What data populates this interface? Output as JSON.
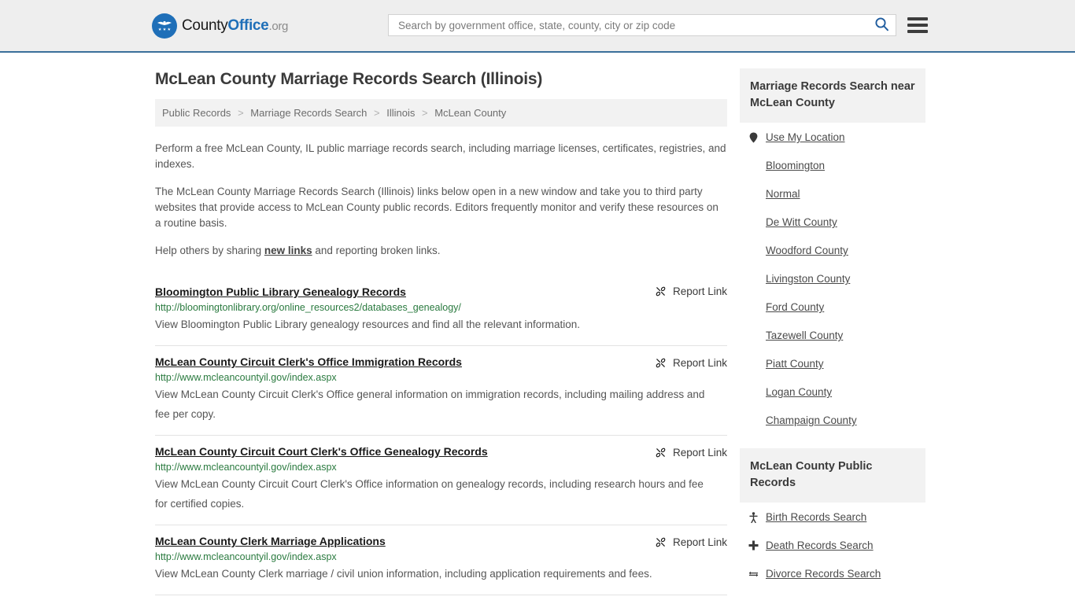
{
  "header": {
    "logo": {
      "part1": "County",
      "part2": "Office",
      "part3": ".org",
      "icon": "eagle-shield-icon"
    },
    "search": {
      "placeholder": "Search by government office, state, county, city or zip code",
      "value": "",
      "search_icon": "search-icon"
    },
    "menu_icon": "hamburger-menu-icon",
    "accent_color": "#1f6fb8",
    "border_color": "#3a6f9a"
  },
  "main": {
    "title": "McLean County Marriage Records Search (Illinois)",
    "breadcrumb": [
      {
        "label": "Public Records"
      },
      {
        "label": "Marriage Records Search"
      },
      {
        "label": "Illinois"
      },
      {
        "label": "McLean County"
      }
    ],
    "breadcrumb_separator": ">",
    "intro": {
      "p1": "Perform a free McLean County, IL public marriage records search, including marriage licenses, certificates, registries, and indexes.",
      "p2": "The McLean County Marriage Records Search (Illinois) links below open in a new window and take you to third party websites that provide access to McLean County public records. Editors frequently monitor and verify these resources on a routine basis.",
      "p3_before": "Help others by sharing ",
      "p3_link": "new links",
      "p3_after": " and reporting broken links."
    },
    "report_link_label": "Report Link",
    "report_link_icon": "unlink-icon",
    "results": [
      {
        "title": "Bloomington Public Library Genealogy Records",
        "url": "http://bloomingtonlibrary.org/online_resources2/databases_genealogy/",
        "description": "View Bloomington Public Library genealogy resources and find all the relevant information."
      },
      {
        "title": "McLean County Circuit Clerk's Office Immigration Records",
        "url": "http://www.mcleancountyil.gov/index.aspx",
        "description": "View McLean County Circuit Clerk's Office general information on immigration records, including mailing address and fee per copy."
      },
      {
        "title": "McLean County Circuit Court Clerk's Office Genealogy Records",
        "url": "http://www.mcleancountyil.gov/index.aspx",
        "description": "View McLean County Circuit Court Clerk's Office information on genealogy records, including research hours and fee for certified copies."
      },
      {
        "title": "McLean County Clerk Marriage Applications",
        "url": "http://www.mcleancountyil.gov/index.aspx",
        "description": "View McLean County Clerk marriage / civil union information, including application requirements and fees."
      }
    ],
    "url_color": "#2a7a3f"
  },
  "sidebar": {
    "nearby": {
      "heading": "Marriage Records Search near McLean County",
      "items": [
        {
          "label": "Use My Location",
          "icon": "location-pin-icon"
        },
        {
          "label": "Bloomington",
          "icon": ""
        },
        {
          "label": "Normal",
          "icon": ""
        },
        {
          "label": "De Witt County",
          "icon": ""
        },
        {
          "label": "Woodford County",
          "icon": ""
        },
        {
          "label": "Livingston County",
          "icon": ""
        },
        {
          "label": "Ford County",
          "icon": ""
        },
        {
          "label": "Tazewell County",
          "icon": ""
        },
        {
          "label": "Piatt County",
          "icon": ""
        },
        {
          "label": "Logan County",
          "icon": ""
        },
        {
          "label": "Champaign County",
          "icon": ""
        }
      ]
    },
    "public_records": {
      "heading": "McLean County Public Records",
      "items": [
        {
          "label": "Birth Records Search",
          "icon": "baby-icon"
        },
        {
          "label": "Death Records Search",
          "icon": "cross-icon"
        },
        {
          "label": "Divorce Records Search",
          "icon": "split-arrows-icon"
        }
      ]
    }
  }
}
